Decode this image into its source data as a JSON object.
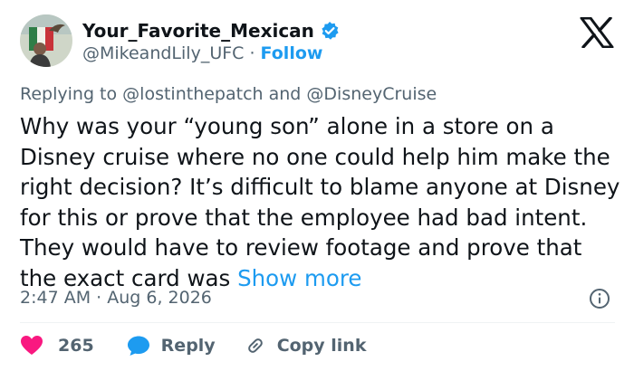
{
  "author": {
    "display_name": "Your_Favorite_Mexican",
    "handle": "@MikeandLily_UFC",
    "separator": " · ",
    "follow_label": "Follow",
    "verified_color": "#1d9bf0"
  },
  "reply_context": {
    "prefix": "Replying to",
    "user1": "@lostinthepatch",
    "joiner": "and",
    "user2": "@DisneyCruise"
  },
  "tweet": {
    "text": "Why was your “young son” alone in a store on a Disney cruise where no one could help him make the right decision? It’s difficult to blame anyone at Disney for this or prove that the employee had bad intent. They would have to review footage and prove that the exact card was",
    "show_more_label": "Show more",
    "timestamp": "2:47 AM · Aug 6, 2026"
  },
  "actions": {
    "like_count": "265",
    "reply_label": "Reply",
    "copy_link_label": "Copy link"
  },
  "colors": {
    "accent": "#1d9bf0",
    "like": "#f91880",
    "muted": "#536471",
    "text": "#0f1419"
  }
}
